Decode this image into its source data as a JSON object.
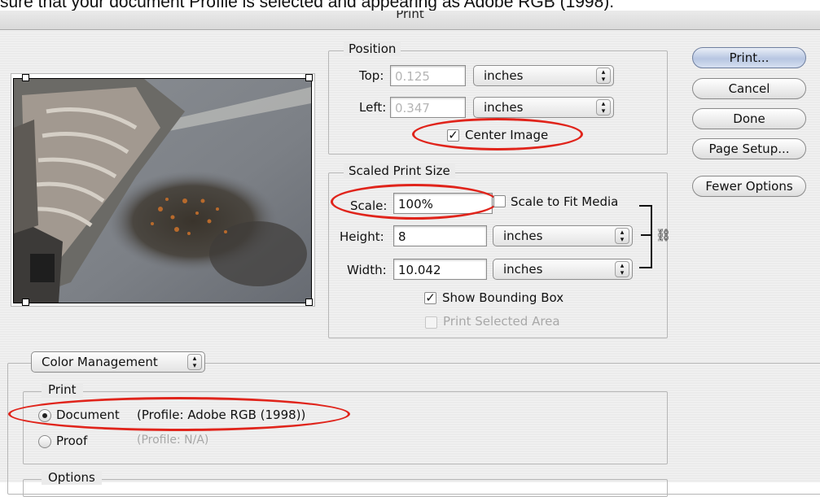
{
  "caption": "sure that your document Profile is selected and appearing as Adobe RGB (1998).",
  "window": {
    "title": "Print"
  },
  "position": {
    "legend": "Position",
    "top_label": "Top:",
    "top_value": "0.125",
    "top_unit": "inches",
    "left_label": "Left:",
    "left_value": "0.347",
    "left_unit": "inches",
    "center_image_label": "Center Image",
    "center_image_checked": true
  },
  "scaled": {
    "legend": "Scaled Print Size",
    "scale_label": "Scale:",
    "scale_value": "100%",
    "fit_media_label": "Scale to Fit Media",
    "height_label": "Height:",
    "height_value": "8",
    "height_unit": "inches",
    "width_label": "Width:",
    "width_value": "10.042",
    "width_unit": "inches",
    "bounding_box_label": "Show Bounding Box",
    "selected_area_label": "Print Selected Area"
  },
  "buttons": {
    "print": "Print...",
    "cancel": "Cancel",
    "done": "Done",
    "page_setup": "Page Setup...",
    "fewer_options": "Fewer Options"
  },
  "color_mgmt": {
    "popup_label": "Color Management",
    "print_legend": "Print",
    "document_label": "Document",
    "document_profile": "(Profile: Adobe RGB (1998))",
    "proof_label": "Proof",
    "proof_profile": "(Profile: N/A)",
    "options_legend": "Options"
  },
  "colors": {
    "highlight_ellipse": "#e0241b",
    "default_button": "#b7c6e1"
  }
}
